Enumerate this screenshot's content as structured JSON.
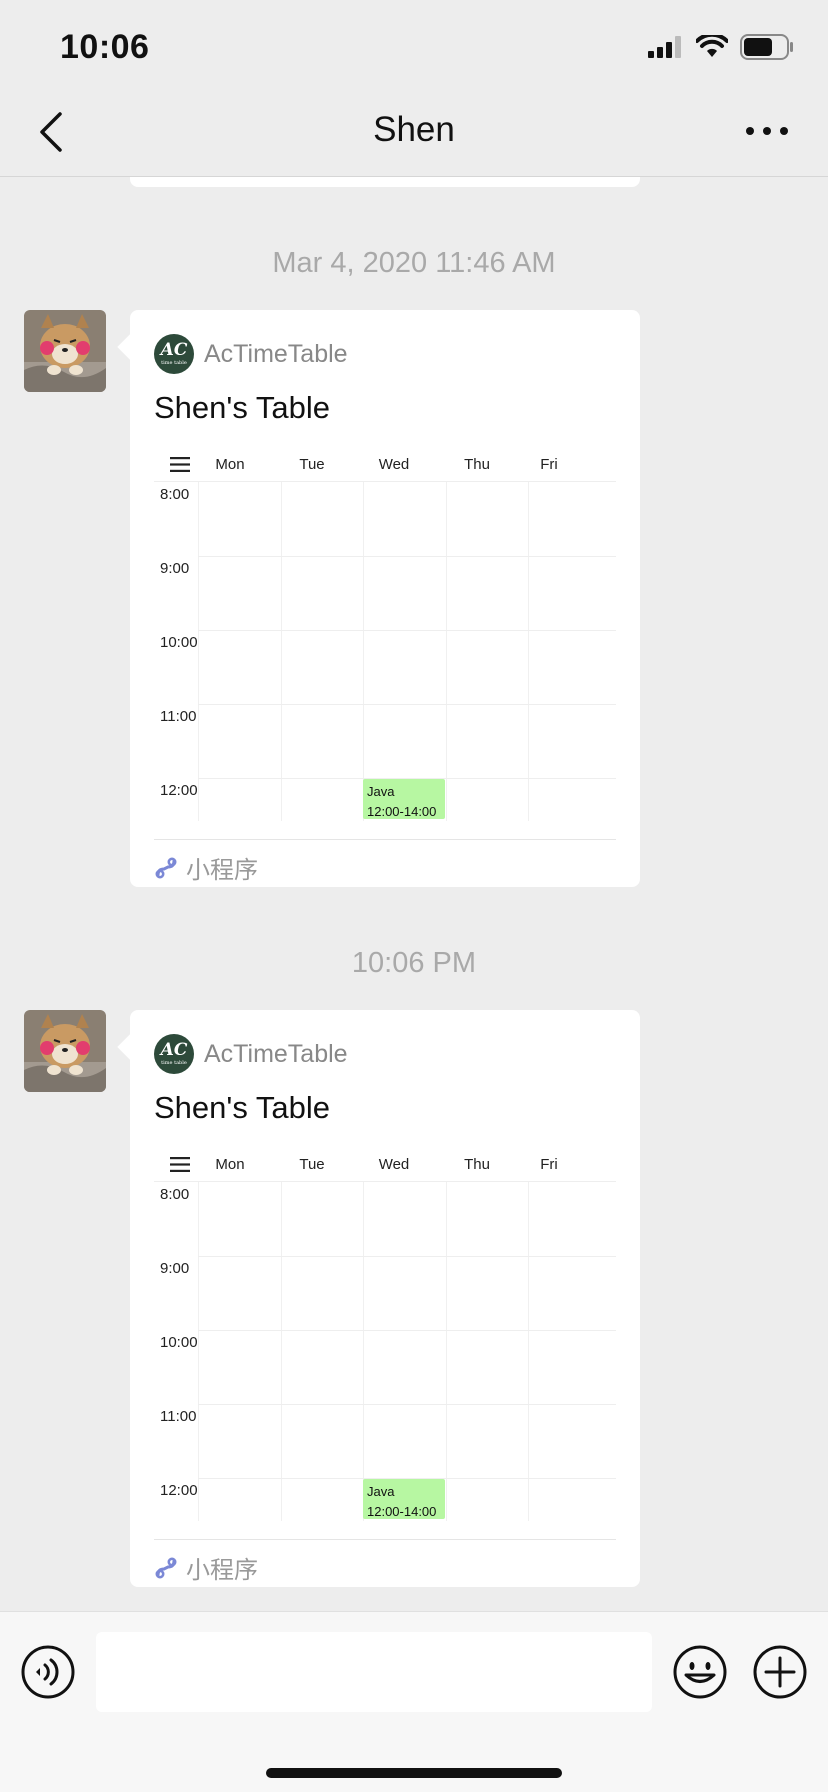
{
  "status_bar": {
    "time": "10:06"
  },
  "nav": {
    "title": "Shen"
  },
  "messages": [
    {
      "timestamp": "Mar 4, 2020 11:46 AM",
      "card": {
        "app_name": "AcTimeTable",
        "logo_text": "AC",
        "logo_subtext": "time table",
        "title": "Shen's Table",
        "days": [
          "Mon",
          "Tue",
          "Wed",
          "Thu",
          "Fri"
        ],
        "times": [
          "8:00",
          "9:00",
          "10:00",
          "11:00",
          "12:00"
        ],
        "course": {
          "name": "Java",
          "time": "12:00-14:00",
          "day": "Wed"
        },
        "footer_label": "小程序"
      }
    },
    {
      "timestamp": "10:06 PM",
      "card": {
        "app_name": "AcTimeTable",
        "logo_text": "AC",
        "logo_subtext": "time table",
        "title": "Shen's Table",
        "days": [
          "Mon",
          "Tue",
          "Wed",
          "Thu",
          "Fri"
        ],
        "times": [
          "8:00",
          "9:00",
          "10:00",
          "11:00",
          "12:00"
        ],
        "course": {
          "name": "Java",
          "time": "12:00-14:00",
          "day": "Wed"
        },
        "footer_label": "小程序"
      }
    }
  ],
  "input": {
    "placeholder": ""
  },
  "icons": {
    "back": "chevron-left-icon",
    "more": "more-dots-icon",
    "voice": "voice-icon",
    "emoji": "emoji-icon",
    "plus": "plus-icon",
    "mini_program": "mini-program-icon",
    "menu": "menu-icon"
  },
  "colors": {
    "course_bg": "#b7f7a2",
    "logo_bg": "#2d4a3a",
    "mini_icon": "#7b88d6"
  }
}
